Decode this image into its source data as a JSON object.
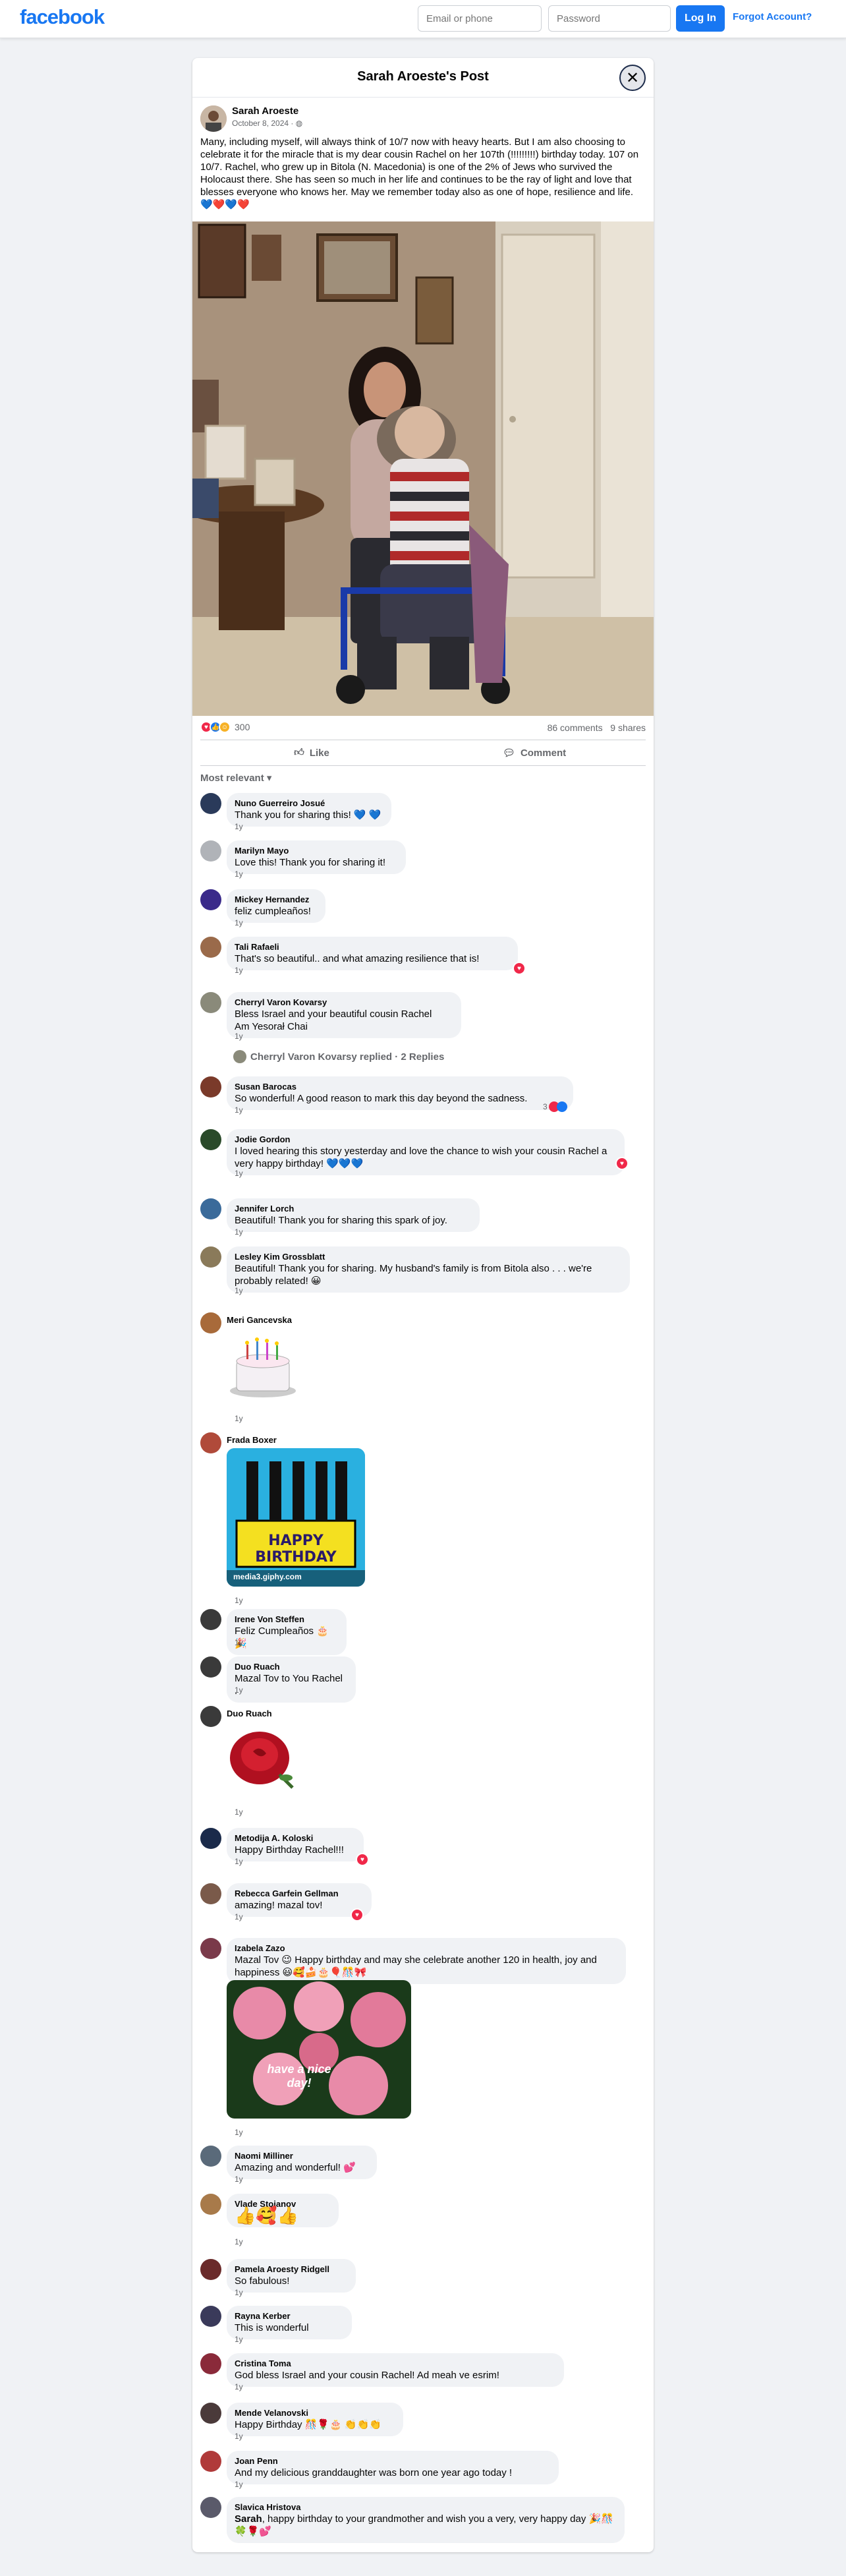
{
  "topbar": {
    "logo": "facebook",
    "email_placeholder": "Email or phone",
    "password_placeholder": "Password",
    "login_label": "Log In",
    "forgot_label": "Forgot Account?"
  },
  "post": {
    "title": "Sarah Aroeste's Post",
    "author": "Sarah Aroeste",
    "date": "October 8, 2024 · ",
    "text": "Many, including myself, will always think of 10/7 now with heavy hearts. But I am also choosing to celebrate it for the miracle that is my dear cousin Rachel on her 107th (!!!!!!!!!) birthday today. 107 on 10/7. Rachel, who grew up in Bitola (N. Macedonia) is one of the 2% of Jews who survived the Holocaust there. She has seen so much in her life and continues to be the ray of light and love that blesses everyone who knows her. May we remember today also as one of hope, resilience and life. 💙❤️💙❤️",
    "reaction_count": "300",
    "comments_count": "86 comments",
    "shares_count": "9 shares",
    "like_label": "Like",
    "comment_label": "Comment",
    "sort_label": "Most relevant"
  },
  "comments": [
    {
      "name": "Nuno Guerreiro Josué",
      "text": "Thank you for sharing this! 💙 💙",
      "time": "1y"
    },
    {
      "name": "Marilyn Mayo",
      "text": "Love this! Thank you for sharing it!",
      "time": "1y"
    },
    {
      "name": "Mickey Hernandez",
      "text": "feliz cumpleaños!",
      "time": "1y"
    },
    {
      "name": "Tali Rafaeli",
      "text": "That's so beautiful.. and what amazing resilience that is!",
      "time": "1y"
    },
    {
      "name": "Cherryl Varon Kovarsy",
      "text": "Bless Israel and your beautiful cousin Rachel\nAm Yesorał Chai",
      "time": "1y",
      "replies": "Cherryl Varon Kovarsy replied · 2 Replies"
    },
    {
      "name": "Susan Barocas",
      "text": "So wonderful! A good reason to mark this day beyond the sadness.",
      "time": "1y",
      "react_count": "3"
    },
    {
      "name": "Jodie Gordon",
      "text": "I loved hearing this story yesterday and love the chance to wish your cousin Rachel a very happy birthday! 💙💙💙",
      "time": "1y"
    },
    {
      "name": "Jennifer Lorch",
      "text": "Beautiful! Thank you for sharing this spark of joy.",
      "time": "1y"
    },
    {
      "name": "Lesley Kim Grossblatt",
      "text": "Beautiful! Thank you for sharing. My husband's family is from Bitola also . . . we're probably related! 😀",
      "time": "1y"
    },
    {
      "name": "Meri Gancevska",
      "text": "",
      "time": "1y"
    },
    {
      "name": "Frada Boxer",
      "text": "",
      "time": "1y",
      "gif_caption": "media3.giphy.com",
      "gif_text": "HAPPY BIRTHDAY"
    },
    {
      "name": "Irene Von Steffen",
      "text": "Feliz Cumpleaños 🎂🎉",
      "time": "1y"
    },
    {
      "name": "Duo Ruach",
      "text": "Mazal Tov to You Rachel .",
      "time": "1y"
    },
    {
      "name": "Duo Ruach",
      "text": "",
      "time": "1y"
    },
    {
      "name": "Metodija A. Koloski",
      "text": "Happy Birthday Rachel!!!",
      "time": "1y"
    },
    {
      "name": "Rebecca Garfein Gellman",
      "text": "amazing! mazal tov!",
      "time": "1y"
    },
    {
      "name": "Izabela Zazo",
      "text": "Mazal Tov 😉 Happy birthday and may she celebrate another 120 in health, joy and happiness 😃🥰🍰🎂🎈🎊🎀",
      "time": "1y",
      "img_text": "have a nice day!"
    },
    {
      "name": "Naomi Milliner",
      "text": "Amazing and wonderful! 💕",
      "time": "1y"
    },
    {
      "name": "Vlade Stojanov",
      "text": "👍🥰👍",
      "time": "1y"
    },
    {
      "name": "Pamela Aroesty Ridgell",
      "text": "So fabulous!",
      "time": "1y"
    },
    {
      "name": "Rayna Kerber",
      "text": "This is wonderful",
      "time": "1y"
    },
    {
      "name": "Cristina Toma",
      "text": "God bless Israel and your cousin Rachel! Ad meah ve esrim!",
      "time": "1y"
    },
    {
      "name": "Mende Velanovski",
      "text": "Happy Birthday 🎊🌹🎂 👏👏👏",
      "time": "1y"
    },
    {
      "name": "Joan Penn",
      "text": "And my delicious granddaughter was born one year ago today !",
      "time": "1y"
    },
    {
      "name": "Slavica Hristova",
      "text_bold": "Sarah",
      "text": ", happy birthday to your grandmother and wish you a very, very happy day 🎉🎊🍀🌹💕",
      "time": ""
    }
  ],
  "colors": {
    "brand": "#1877f2",
    "love": "#f02849"
  }
}
